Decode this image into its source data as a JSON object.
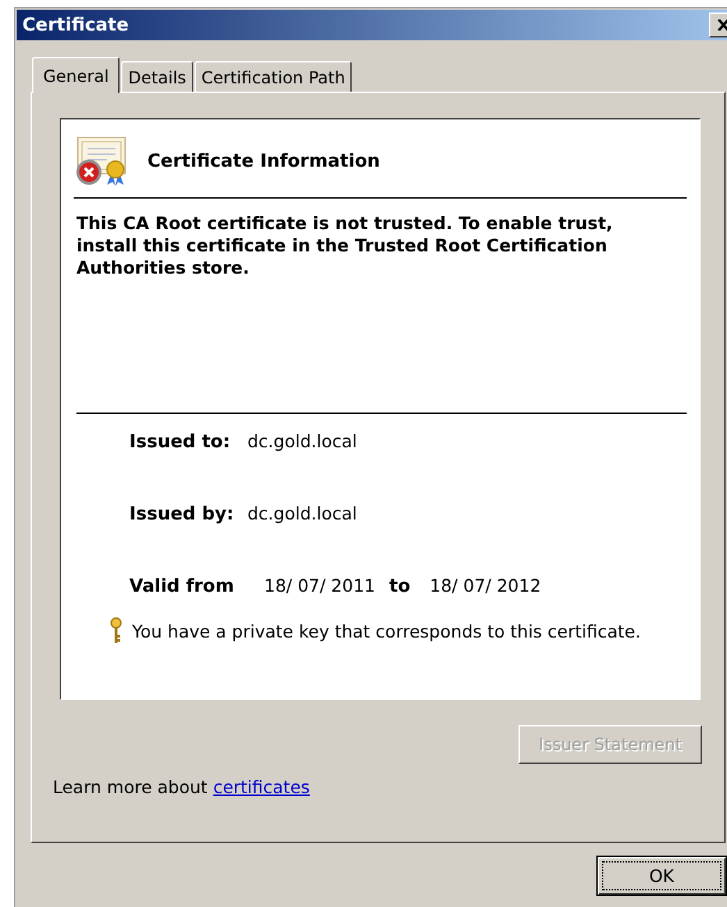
{
  "window": {
    "title": "Certificate"
  },
  "tabs": [
    {
      "label": "General",
      "selected": true
    },
    {
      "label": "Details",
      "selected": false
    },
    {
      "label": "Certification Path",
      "selected": false
    }
  ],
  "info": {
    "heading": "Certificate Information",
    "trusted": false,
    "message": "This CA Root certificate is not trusted. To enable trust, install this certificate in the Trusted Root Certification Authorities store."
  },
  "fields": [
    {
      "label": "Issued to:",
      "value": "dc.gold.local"
    },
    {
      "label": "Issued by:",
      "value": "dc.gold.local"
    }
  ],
  "validity": {
    "label": "Valid from",
    "from": "18/ 07/ 2011",
    "to_label": "to",
    "to": "18/ 07/ 2012"
  },
  "private_key_note": "You have a private key that corresponds to this certificate.",
  "issuer_statement_button": {
    "label": "Issuer Statement",
    "disabled": true
  },
  "learn_more": {
    "text": "Learn more about",
    "link": "certificates"
  },
  "buttons": [
    {
      "label": "OK",
      "focused": true
    }
  ]
}
